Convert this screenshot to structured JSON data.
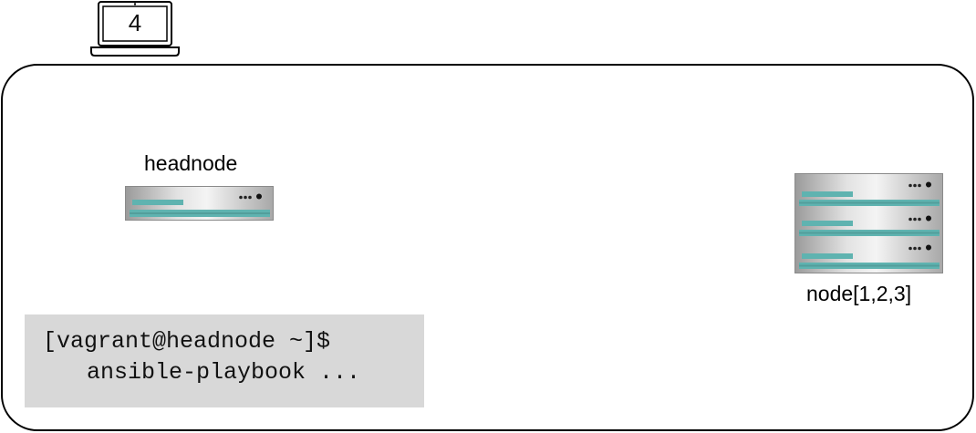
{
  "laptop": {
    "icon": "laptop-icon",
    "number": "4"
  },
  "cluster": {
    "headnode": {
      "label": "headnode",
      "icon": "server-icon"
    },
    "compute_nodes": {
      "label": "node[1,2,3]",
      "icon": "server-rack-icon"
    }
  },
  "terminal": {
    "prompt": "[vagrant@headnode ~]$",
    "command": "ansible-playbook ..."
  },
  "colors": {
    "accent": "#5fb3b0",
    "server_body": "#c8c8c8",
    "terminal_bg": "#d8d8d8"
  }
}
